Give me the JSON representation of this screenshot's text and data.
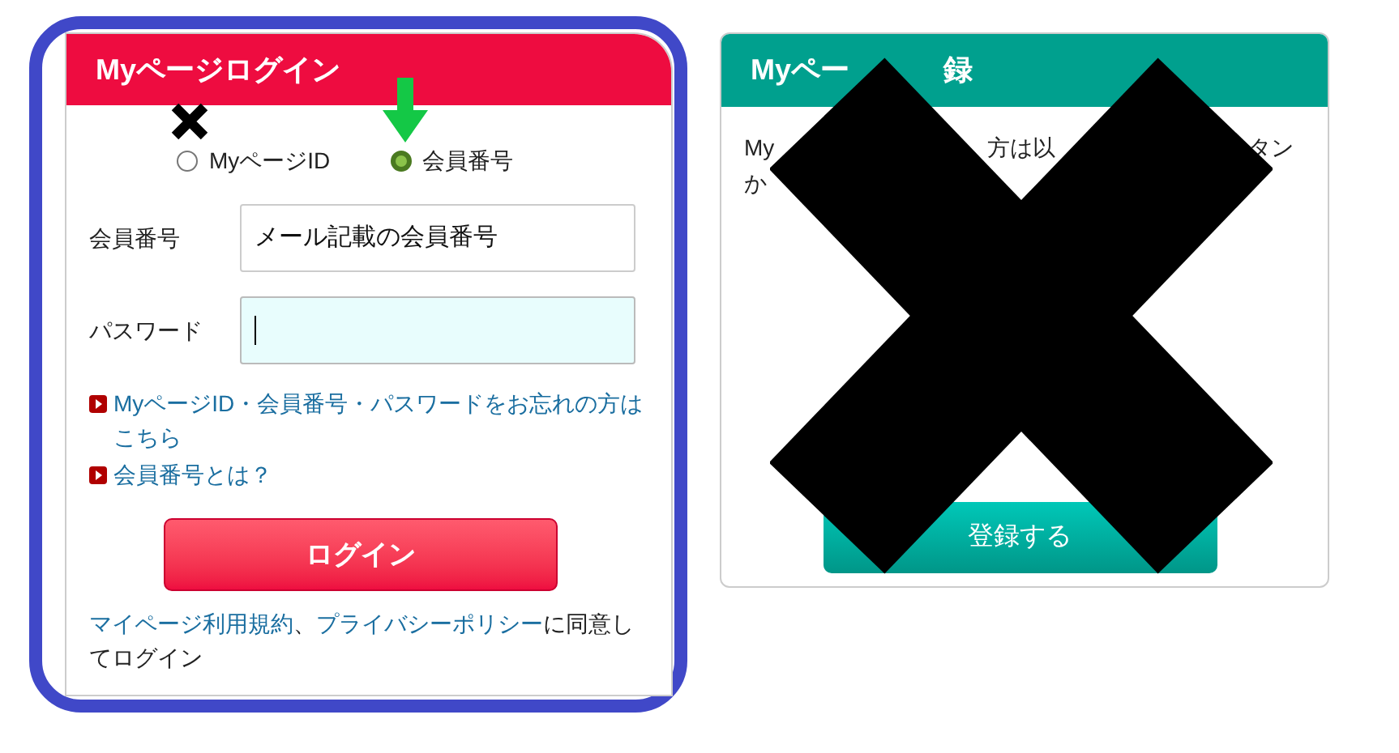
{
  "login": {
    "title": "Myページログイン",
    "modes": [
      {
        "label": "MyページID",
        "selected": false
      },
      {
        "label": "会員番号",
        "selected": true
      }
    ],
    "fields": [
      {
        "label": "会員番号",
        "value": "メール記載の会員番号",
        "focused": false
      },
      {
        "label": "パスワード",
        "focused": true
      }
    ],
    "links": [
      {
        "text": "MyページID・会員番号・パスワードをお忘れの方はこちら"
      },
      {
        "text": "会員番号とは？"
      }
    ],
    "button": "ログイン",
    "agreement": [
      {
        "text": "マイページ利用規約",
        "kind": "link"
      },
      {
        "text": "、",
        "kind": "plain"
      },
      {
        "text": "プライバシーポリシー",
        "kind": "link"
      },
      {
        "text": "に同意してログイン",
        "kind": "plain"
      }
    ]
  },
  "register": {
    "title_parts": [
      "Myペー",
      "録"
    ],
    "text_lines": [
      [
        "My",
        "方は以",
        "タン"
      ],
      [
        "か"
      ]
    ],
    "button": "登録する"
  }
}
